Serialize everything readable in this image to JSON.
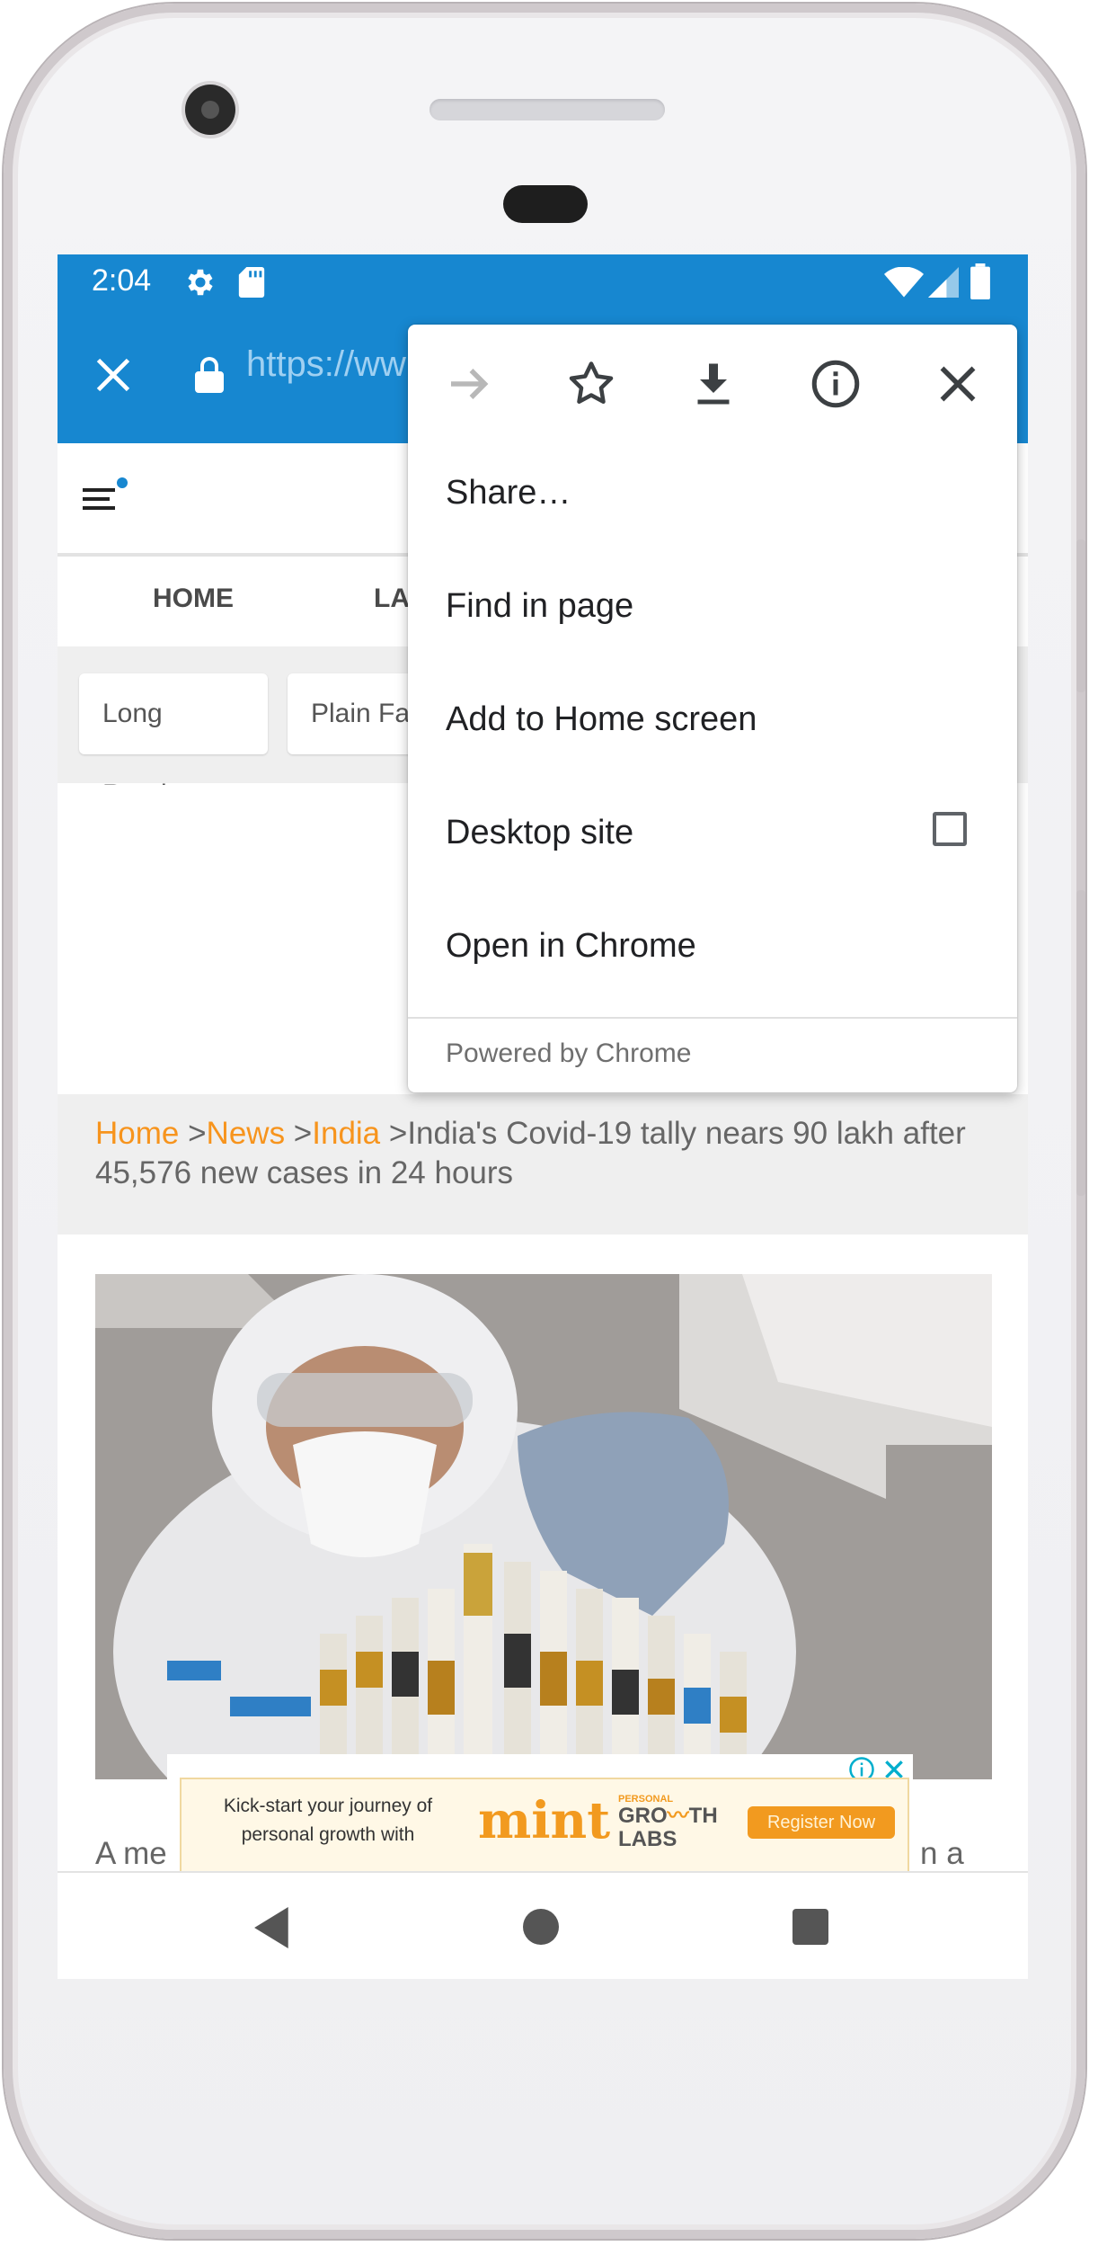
{
  "status_bar": {
    "time": "2:04"
  },
  "toolbar": {
    "url_text": "https://ww"
  },
  "site_nav": {
    "items": [
      "HOME",
      "LA"
    ]
  },
  "chips": [
    "Long Reads",
    "Plain Fa"
  ],
  "breadcrumb": {
    "home": "Home",
    "news": "News",
    "india": "India",
    "sep": " >",
    "title": "India's Covid-19 tally nears 90 lakh after 45,576 new cases in 24 hours"
  },
  "article": {
    "caption_left": "A me\nlabor",
    "caption_right": "n a"
  },
  "ad": {
    "text": "Kick-start your journey of personal growth with",
    "brand": "mint",
    "brand_sub_top": "GRO",
    "brand_sub_tail": "TH",
    "brand_sub_bottom": "LABS",
    "brand_personal": "PERSONAL",
    "cta": "Register Now"
  },
  "menu": {
    "items": [
      "Share…",
      "Find in page",
      "Add to Home screen",
      "Desktop site",
      "Open in Chrome"
    ],
    "footer": "Powered by Chrome",
    "desktop_site_checked": false
  },
  "colors": {
    "chrome_blue": "#1787d0",
    "link_orange": "#f7941d"
  }
}
